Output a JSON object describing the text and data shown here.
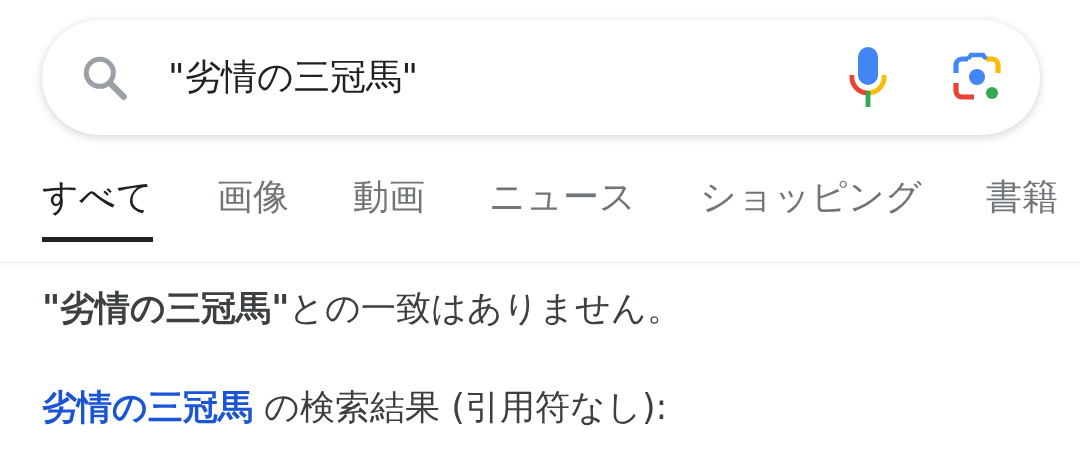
{
  "search": {
    "value": "\"劣情の三冠馬\""
  },
  "tabs": [
    {
      "label": "すべて",
      "selected": true
    },
    {
      "label": "画像",
      "selected": false
    },
    {
      "label": "動画",
      "selected": false
    },
    {
      "label": "ニュース",
      "selected": false
    },
    {
      "label": "ショッピング",
      "selected": false
    },
    {
      "label": "書籍",
      "selected": false
    }
  ],
  "no_match": "**\"劣情の三冠馬\"**との一致はありません。",
  "suggestion": {
    "link": "劣情の三冠馬",
    "text": " の検索結果 (引用符なし):"
  }
}
